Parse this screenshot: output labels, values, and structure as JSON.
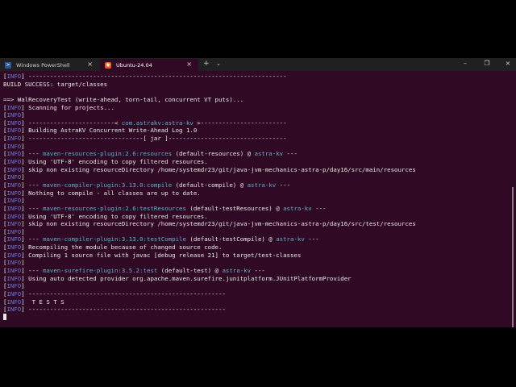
{
  "tabs": [
    {
      "label": "Windows PowerShell",
      "icon": "powershell-icon"
    },
    {
      "label": "Ubuntu-24.04",
      "icon": "ubuntu-icon",
      "active": true
    }
  ],
  "colors": {
    "background": "#300a24",
    "info": "#6b78d8",
    "plugin": "#5fb0cc",
    "text": "#e8e8e8"
  },
  "terminal": {
    "lines": [
      [
        {
          "t": "[",
          "c": ""
        },
        {
          "t": "INFO",
          "c": "inf"
        },
        {
          "t": "] ------------------------------------------------------------------------",
          "c": ""
        }
      ],
      [
        {
          "t": "BUILD SUCCESS: target/classes",
          "c": ""
        }
      ],
      [
        {
          "t": "",
          "c": ""
        }
      ],
      [
        {
          "t": "==> WalRecoveryTest (write-ahead, torn-tail, concurrent VT puts)...",
          "c": ""
        }
      ],
      [
        {
          "t": "[",
          "c": ""
        },
        {
          "t": "INFO",
          "c": "inf"
        },
        {
          "t": "] Scanning for projects...",
          "c": ""
        }
      ],
      [
        {
          "t": "[",
          "c": ""
        },
        {
          "t": "INFO",
          "c": "inf"
        },
        {
          "t": "]",
          "c": ""
        }
      ],
      [
        {
          "t": "[",
          "c": ""
        },
        {
          "t": "INFO",
          "c": "inf"
        },
        {
          "t": "] ------------------------< ",
          "c": ""
        },
        {
          "t": "com.astrakv:astra-kv",
          "c": "plug"
        },
        {
          "t": " >------------------------",
          "c": ""
        }
      ],
      [
        {
          "t": "[",
          "c": ""
        },
        {
          "t": "INFO",
          "c": "inf"
        },
        {
          "t": "] Building AstraKV Concurrent Write-Ahead Log 1.0",
          "c": ""
        }
      ],
      [
        {
          "t": "[",
          "c": ""
        },
        {
          "t": "INFO",
          "c": "inf"
        },
        {
          "t": "] --------------------------------[ jar ]---------------------------------",
          "c": ""
        }
      ],
      [
        {
          "t": "[",
          "c": ""
        },
        {
          "t": "INFO",
          "c": "inf"
        },
        {
          "t": "]",
          "c": ""
        }
      ],
      [
        {
          "t": "[",
          "c": ""
        },
        {
          "t": "INFO",
          "c": "inf"
        },
        {
          "t": "] --- ",
          "c": ""
        },
        {
          "t": "maven-resources-plugin:2.6:resources",
          "c": "plug"
        },
        {
          "t": " (default-resources) @ ",
          "c": ""
        },
        {
          "t": "astra-kv",
          "c": "plug"
        },
        {
          "t": " ---",
          "c": ""
        }
      ],
      [
        {
          "t": "[",
          "c": ""
        },
        {
          "t": "INFO",
          "c": "inf"
        },
        {
          "t": "] Using 'UTF-8' encoding to copy filtered resources.",
          "c": ""
        }
      ],
      [
        {
          "t": "[",
          "c": ""
        },
        {
          "t": "INFO",
          "c": "inf"
        },
        {
          "t": "] skip non existing resourceDirectory /home/systemdr23/git/java-jvm-mechanics-astra-p/day16/src/main/resources",
          "c": ""
        }
      ],
      [
        {
          "t": "[",
          "c": ""
        },
        {
          "t": "INFO",
          "c": "inf"
        },
        {
          "t": "]",
          "c": ""
        }
      ],
      [
        {
          "t": "[",
          "c": ""
        },
        {
          "t": "INFO",
          "c": "inf"
        },
        {
          "t": "] --- ",
          "c": ""
        },
        {
          "t": "maven-compiler-plugin:3.13.0:compile",
          "c": "plug"
        },
        {
          "t": " (default-compile) @ ",
          "c": ""
        },
        {
          "t": "astra-kv",
          "c": "plug"
        },
        {
          "t": " ---",
          "c": ""
        }
      ],
      [
        {
          "t": "[",
          "c": ""
        },
        {
          "t": "INFO",
          "c": "inf"
        },
        {
          "t": "] Nothing to compile - all classes are up to date.",
          "c": ""
        }
      ],
      [
        {
          "t": "[",
          "c": ""
        },
        {
          "t": "INFO",
          "c": "inf"
        },
        {
          "t": "]",
          "c": ""
        }
      ],
      [
        {
          "t": "[",
          "c": ""
        },
        {
          "t": "INFO",
          "c": "inf"
        },
        {
          "t": "] --- ",
          "c": ""
        },
        {
          "t": "maven-resources-plugin:2.6:testResources",
          "c": "plug"
        },
        {
          "t": " (default-testResources) @ ",
          "c": ""
        },
        {
          "t": "astra-kv",
          "c": "plug"
        },
        {
          "t": " ---",
          "c": ""
        }
      ],
      [
        {
          "t": "[",
          "c": ""
        },
        {
          "t": "INFO",
          "c": "inf"
        },
        {
          "t": "] Using 'UTF-8' encoding to copy filtered resources.",
          "c": ""
        }
      ],
      [
        {
          "t": "[",
          "c": ""
        },
        {
          "t": "INFO",
          "c": "inf"
        },
        {
          "t": "] skip non existing resourceDirectory /home/systemdr23/git/java-jvm-mechanics-astra-p/day16/src/test/resources",
          "c": ""
        }
      ],
      [
        {
          "t": "[",
          "c": ""
        },
        {
          "t": "INFO",
          "c": "inf"
        },
        {
          "t": "]",
          "c": ""
        }
      ],
      [
        {
          "t": "[",
          "c": ""
        },
        {
          "t": "INFO",
          "c": "inf"
        },
        {
          "t": "] --- ",
          "c": ""
        },
        {
          "t": "maven-compiler-plugin:3.13.0:testCompile",
          "c": "plug"
        },
        {
          "t": " (default-testCompile) @ ",
          "c": ""
        },
        {
          "t": "astra-kv",
          "c": "plug"
        },
        {
          "t": " ---",
          "c": ""
        }
      ],
      [
        {
          "t": "[",
          "c": ""
        },
        {
          "t": "INFO",
          "c": "inf"
        },
        {
          "t": "] Recompiling the module because of changed source code.",
          "c": ""
        }
      ],
      [
        {
          "t": "[",
          "c": ""
        },
        {
          "t": "INFO",
          "c": "inf"
        },
        {
          "t": "] Compiling 1 source file with javac [debug release 21] to target/test-classes",
          "c": ""
        }
      ],
      [
        {
          "t": "[",
          "c": ""
        },
        {
          "t": "INFO",
          "c": "inf"
        },
        {
          "t": "]",
          "c": ""
        }
      ],
      [
        {
          "t": "[",
          "c": ""
        },
        {
          "t": "INFO",
          "c": "inf"
        },
        {
          "t": "] --- ",
          "c": ""
        },
        {
          "t": "maven-surefire-plugin:3.5.2:test",
          "c": "plug"
        },
        {
          "t": " (default-test) @ ",
          "c": ""
        },
        {
          "t": "astra-kv",
          "c": "plug"
        },
        {
          "t": " ---",
          "c": ""
        }
      ],
      [
        {
          "t": "[",
          "c": ""
        },
        {
          "t": "INFO",
          "c": "inf"
        },
        {
          "t": "] Using auto detected provider org.apache.maven.surefire.junitplatform.JUnitPlatformProvider",
          "c": ""
        }
      ],
      [
        {
          "t": "[",
          "c": ""
        },
        {
          "t": "INFO",
          "c": "inf"
        },
        {
          "t": "]",
          "c": ""
        }
      ],
      [
        {
          "t": "[",
          "c": ""
        },
        {
          "t": "INFO",
          "c": "inf"
        },
        {
          "t": "] -------------------------------------------------------",
          "c": ""
        }
      ],
      [
        {
          "t": "[",
          "c": ""
        },
        {
          "t": "INFO",
          "c": "inf"
        },
        {
          "t": "]  T E S T S",
          "c": ""
        }
      ],
      [
        {
          "t": "[",
          "c": ""
        },
        {
          "t": "INFO",
          "c": "inf"
        },
        {
          "t": "] -------------------------------------------------------",
          "c": ""
        }
      ]
    ]
  }
}
